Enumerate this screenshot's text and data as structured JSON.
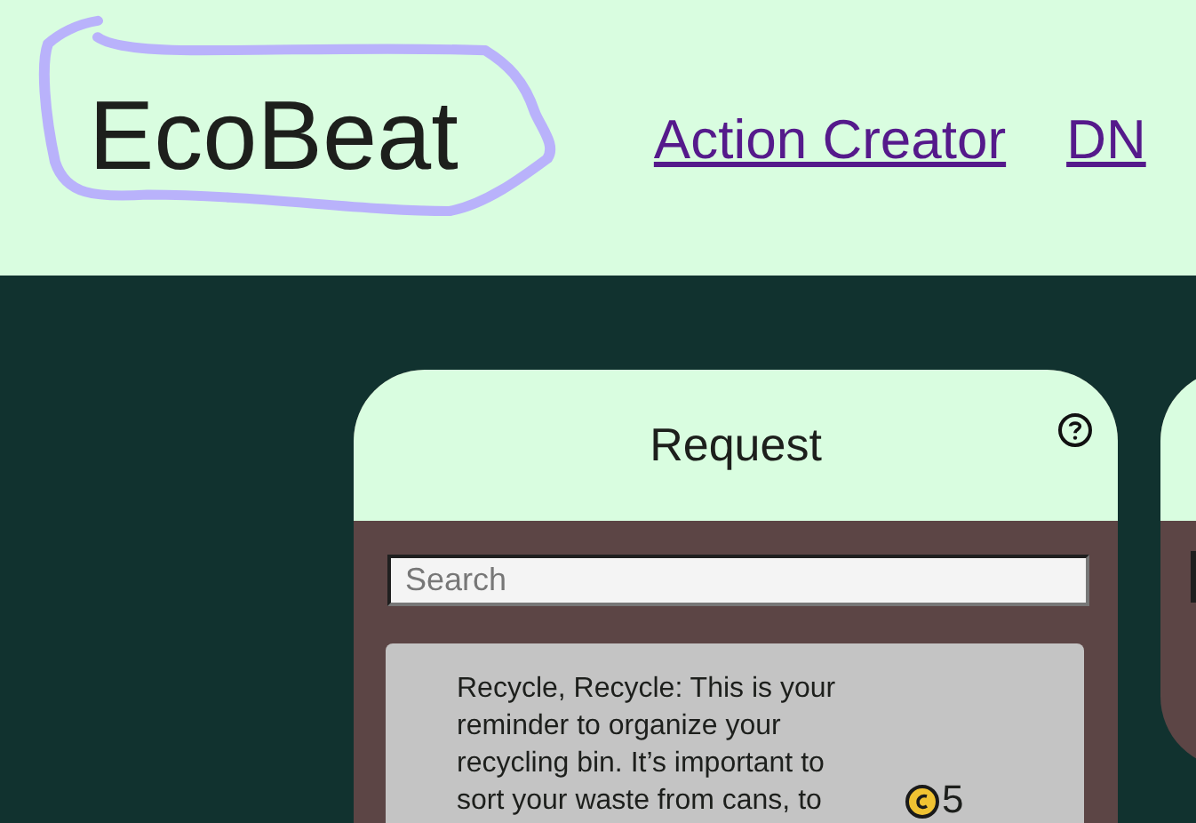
{
  "header": {
    "logo": "EcoBeat",
    "nav_links": [
      {
        "label": "Action Creator"
      },
      {
        "label": "DN"
      }
    ]
  },
  "panels": [
    {
      "kind": "full",
      "title": "Request",
      "search": {
        "placeholder": "Search"
      },
      "items": [
        {
          "text": "Recycle, Recycle: This is your reminder to organize your recycling bin. It’s important to sort your waste from cans, to",
          "points": "5"
        }
      ]
    },
    {
      "kind": "partial"
    }
  ]
}
